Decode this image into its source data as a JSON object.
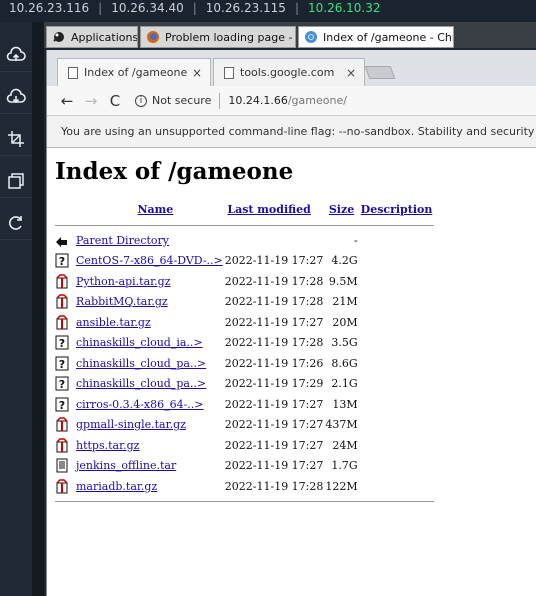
{
  "topbar": {
    "ips": [
      "10.26.23.116",
      "10.26.34.40",
      "10.26.23.115",
      "10.26.10.32"
    ],
    "active_ip": "10.26.10.32"
  },
  "sidebar": {
    "buttons": [
      "upload-cloud-icon",
      "download-cloud-icon",
      "crop-icon",
      "copy-icon",
      "refresh-icon"
    ]
  },
  "taskbar": {
    "items": [
      {
        "label": "Applications",
        "icon": "applications-icon"
      },
      {
        "label": "Problem loading page - ...",
        "icon": "firefox-icon"
      },
      {
        "label": "Index of /gameone - Chr...",
        "icon": "chrome-icon"
      }
    ]
  },
  "tabs": [
    {
      "label": "Index of /gameone",
      "close": "×"
    },
    {
      "label": "tools.google.com",
      "close": "×"
    }
  ],
  "toolbar": {
    "security": "Not secure",
    "url_host": "10.24.1.66",
    "url_path": "/gameone/"
  },
  "infobar": {
    "text": "You are using an unsupported command-line flag: --no-sandbox. Stability and security"
  },
  "page": {
    "title": "Index of /gameone",
    "columns": [
      "Name",
      "Last modified",
      "Size",
      "Description"
    ],
    "parent": {
      "name": "Parent Directory",
      "size": "-"
    },
    "rows": [
      {
        "name": "CentOS-7-x86_64-DVD-..>",
        "modified": "2022-11-19 17:27",
        "size": "4.2G",
        "icon": "unknown"
      },
      {
        "name": "Python-api.tar.gz",
        "modified": "2022-11-19 17:28",
        "size": "9.5M",
        "icon": "compressed"
      },
      {
        "name": "RabbitMQ.tar.gz",
        "modified": "2022-11-19 17:28",
        "size": "21M",
        "icon": "compressed"
      },
      {
        "name": "ansible.tar.gz",
        "modified": "2022-11-19 17:27",
        "size": "20M",
        "icon": "compressed"
      },
      {
        "name": "chinaskills_cloud_ia..>",
        "modified": "2022-11-19 17:28",
        "size": "3.5G",
        "icon": "unknown"
      },
      {
        "name": "chinaskills_cloud_pa..>",
        "modified": "2022-11-19 17:26",
        "size": "8.6G",
        "icon": "unknown"
      },
      {
        "name": "chinaskills_cloud_pa..>",
        "modified": "2022-11-19 17:29",
        "size": "2.1G",
        "icon": "unknown"
      },
      {
        "name": "cirros-0.3.4-x86_64-..>",
        "modified": "2022-11-19 17:27",
        "size": "13M",
        "icon": "unknown"
      },
      {
        "name": "gpmall-single.tar.gz",
        "modified": "2022-11-19 17:27",
        "size": "437M",
        "icon": "compressed"
      },
      {
        "name": "https.tar.gz",
        "modified": "2022-11-19 17:27",
        "size": "24M",
        "icon": "compressed"
      },
      {
        "name": "jenkins_offline.tar",
        "modified": "2022-11-19 17:27",
        "size": "1.7G",
        "icon": "text"
      },
      {
        "name": "mariadb.tar.gz",
        "modified": "2022-11-19 17:28",
        "size": "122M",
        "icon": "compressed"
      }
    ]
  }
}
